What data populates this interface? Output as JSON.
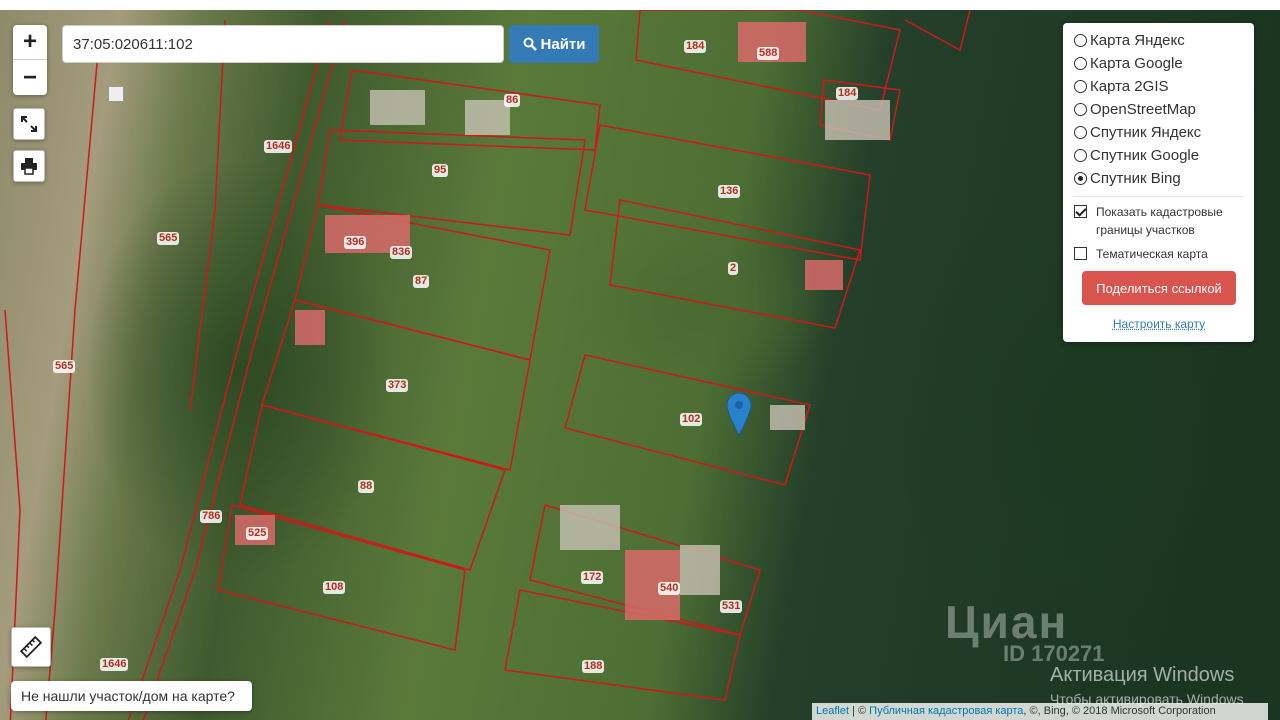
{
  "map": {
    "zoom_in": "+",
    "zoom_out": "−",
    "search": {
      "value": "37:05:020611:102",
      "button_label": "Найти"
    },
    "layers": [
      {
        "label": "Карта Яндекс",
        "selected": false
      },
      {
        "label": "Карта Google",
        "selected": false
      },
      {
        "label": "Карта 2GIS",
        "selected": false
      },
      {
        "label": "OpenStreetMap",
        "selected": false
      },
      {
        "label": "Спутник Яндекс",
        "selected": false
      },
      {
        "label": "Спутник Google",
        "selected": false
      },
      {
        "label": "Спутник Bing",
        "selected": true
      }
    ],
    "options": [
      {
        "label": "Показать кадастровые границы участков",
        "checked": true
      },
      {
        "label": "Тематическая карта",
        "checked": false
      }
    ],
    "share_button": "Поделиться ссылкой",
    "configure_link": "Настроить карту",
    "not_found": "Не нашли участок/дом на карте?",
    "attribution": {
      "leaflet": "Leaflet",
      "sep1": " | © ",
      "pkk": "Публичная кадастровая карта",
      "rest": ", ©, Bing, © 2018 Microsoft Corporation"
    },
    "parcel_labels": [
      "184",
      "588",
      "184",
      "86",
      "1646",
      "95",
      "136",
      "565",
      "396",
      "836",
      "87",
      "2",
      "565",
      "373",
      "102",
      "88",
      "786",
      "525",
      "172",
      "540",
      "531",
      "108",
      "188",
      "1646"
    ],
    "colors": {
      "parcel_border": "#d01818",
      "search_button": "#337ab7",
      "share_button": "#d9534f",
      "marker": "#2a81cb"
    }
  },
  "watermark": {
    "brand": "Циан",
    "id": "ID 170271"
  },
  "windows_notice": {
    "line1": "Активация Windows",
    "line2": "Чтобы активировать Windows"
  }
}
